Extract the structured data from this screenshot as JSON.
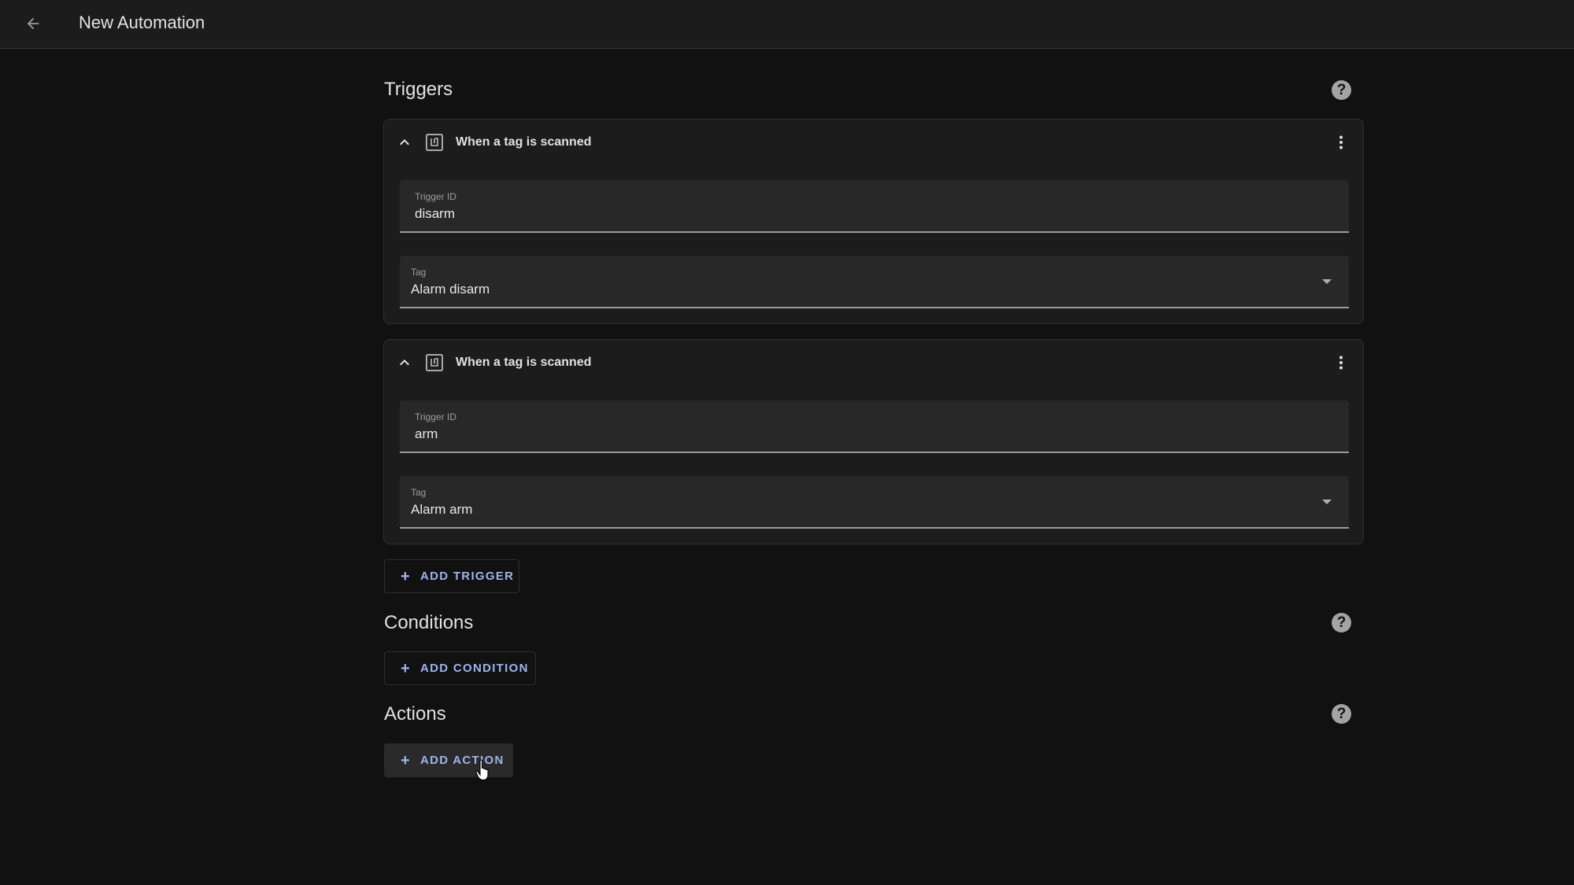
{
  "header": {
    "title": "New Automation",
    "back_icon": "arrow-left-icon"
  },
  "sections": {
    "triggers": {
      "title": "Triggers",
      "help_icon": "help-circle-icon"
    },
    "conditions": {
      "title": "Conditions",
      "help_icon": "help-circle-icon"
    },
    "actions": {
      "title": "Actions",
      "help_icon": "help-circle-icon"
    }
  },
  "help_glyph": "?",
  "triggers": [
    {
      "title": "When a tag is scanned",
      "icon": "nfc-tag-icon",
      "expanded": true,
      "fields": {
        "trigger_id": {
          "label": "Trigger ID",
          "value": "disarm"
        },
        "tag": {
          "label": "Tag",
          "value": "Alarm disarm"
        }
      }
    },
    {
      "title": "When a tag is scanned",
      "icon": "nfc-tag-icon",
      "expanded": true,
      "fields": {
        "trigger_id": {
          "label": "Trigger ID",
          "value": "arm"
        },
        "tag": {
          "label": "Tag",
          "value": "Alarm arm"
        }
      }
    }
  ],
  "buttons": {
    "add_trigger": {
      "label": "ADD TRIGGER",
      "icon": "plus-icon",
      "glyph": "+"
    },
    "add_condition": {
      "label": "ADD CONDITION",
      "icon": "plus-icon",
      "glyph": "+"
    },
    "add_action": {
      "label": "ADD ACTION",
      "icon": "plus-icon",
      "glyph": "+",
      "state": "hover"
    }
  },
  "colors": {
    "accent": "#9db4ec",
    "background": "#111111",
    "card": "#1c1c1c",
    "field": "#282828"
  }
}
